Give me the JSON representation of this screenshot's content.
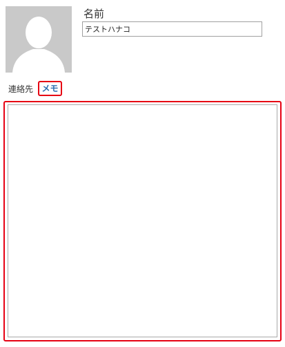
{
  "contact": {
    "name_label": "名前",
    "name_value": "テストハナコ"
  },
  "tabs": {
    "contacts_label": "連絡先",
    "memo_label": "メモ",
    "active": "memo"
  },
  "memo": {
    "value": ""
  },
  "colors": {
    "highlight": "#e60012",
    "active_tab_text": "#2b6cb0",
    "avatar_bg": "#c9c9c9",
    "avatar_silhouette": "#ffffff"
  },
  "icons": {
    "avatar": "person-silhouette-icon"
  }
}
